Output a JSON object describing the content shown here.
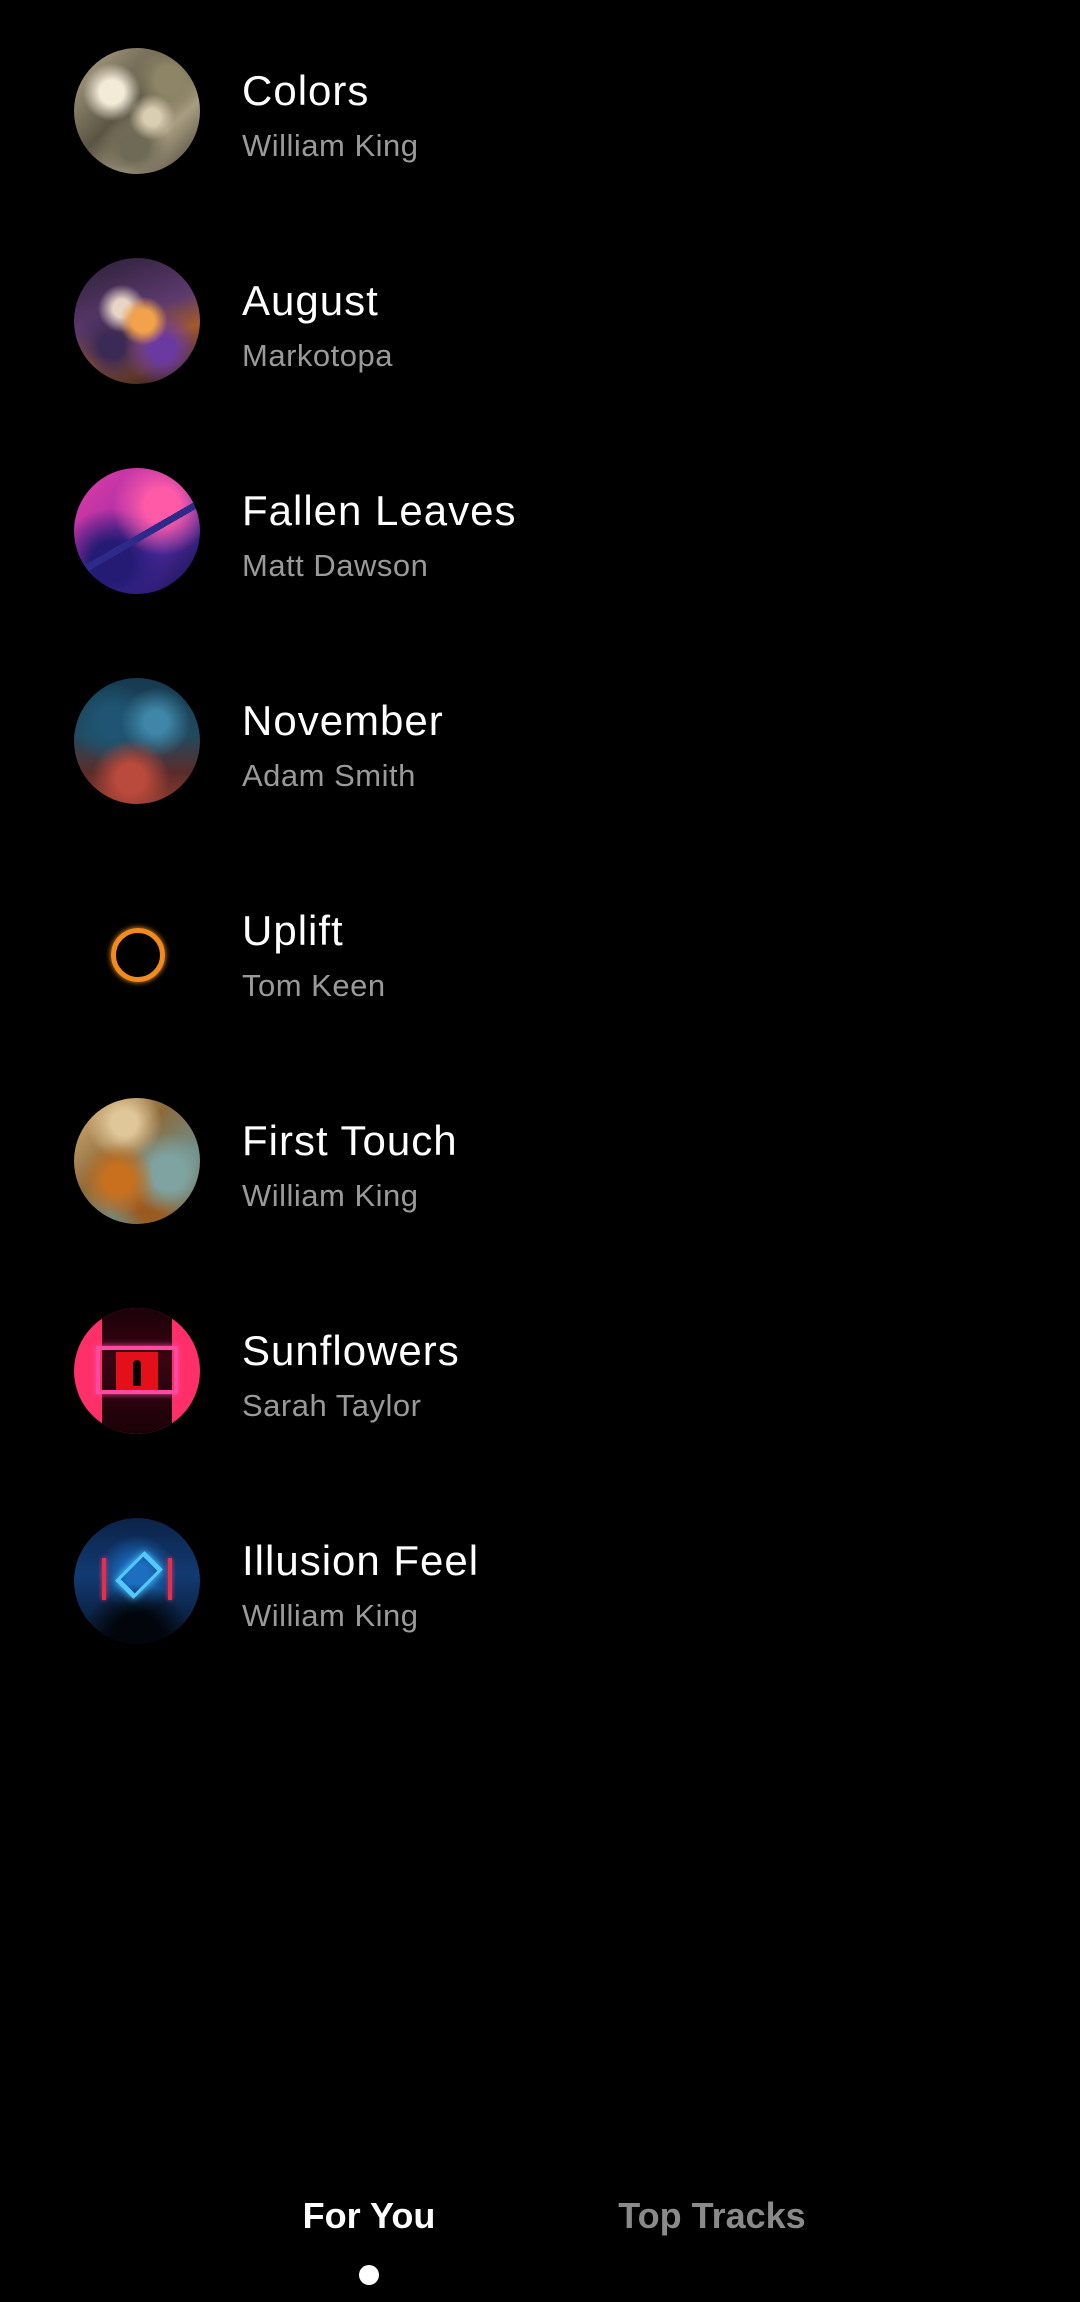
{
  "tracks": [
    {
      "title": "Colors",
      "artist": "William King",
      "artwork": "abstract-marble-beige"
    },
    {
      "title": "August",
      "artist": "Markotopa",
      "artwork": "abstract-swirl-orange-purple"
    },
    {
      "title": "Fallen Leaves",
      "artist": "Matt Dawson",
      "artwork": "abstract-pink-violet"
    },
    {
      "title": "November",
      "artist": "Adam Smith",
      "artwork": "abstract-smoke-blue-red"
    },
    {
      "title": "Uplift",
      "artist": "Tom Keen",
      "artwork": "orange-light-ring"
    },
    {
      "title": "First Touch",
      "artist": "William King",
      "artwork": "abstract-ink-ochre-teal"
    },
    {
      "title": "Sunflowers",
      "artist": "Sarah Taylor",
      "artwork": "neon-red-frame-figure"
    },
    {
      "title": "Illusion Feel",
      "artist": "William King",
      "artwork": "neon-blue-stage"
    }
  ],
  "tabs": [
    {
      "label": "For You",
      "active": true
    },
    {
      "label": "Top Tracks",
      "active": false
    }
  ],
  "colors": {
    "background": "#000000",
    "title": "#ffffff",
    "subtitle": "#9a9a9a",
    "tab_active": "#ffffff",
    "tab_inactive": "#8a8a8a"
  }
}
